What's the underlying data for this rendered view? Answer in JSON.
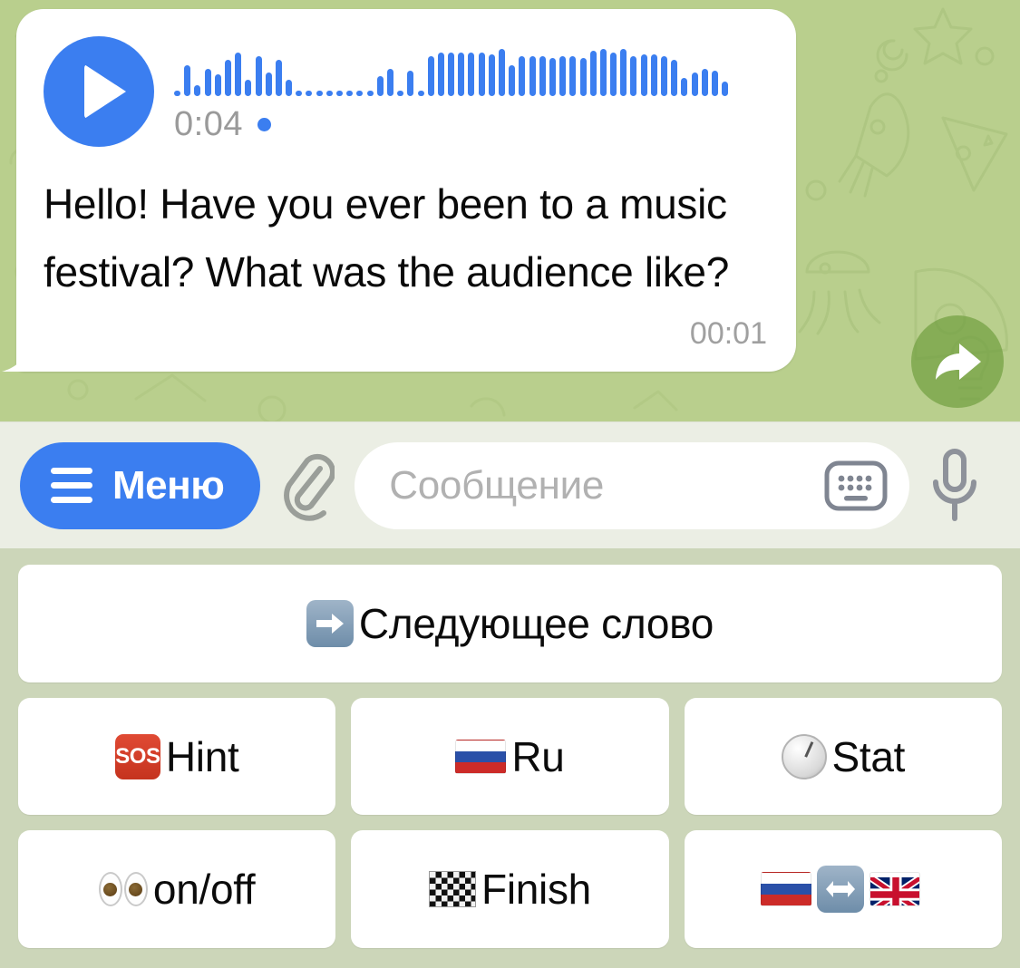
{
  "chat": {
    "background_color": "#b9cf8d",
    "bubble": {
      "voice_message": {
        "duration": "0:04",
        "play_icon": "play-icon",
        "unread_marker": "unread-dot",
        "accent_color": "#3b7ef0",
        "waveform_heights": [
          6,
          34,
          12,
          30,
          24,
          40,
          48,
          18,
          44,
          26,
          40,
          18,
          6,
          6,
          6,
          6,
          6,
          6,
          6,
          6,
          22,
          30,
          6,
          28,
          6,
          44,
          48,
          48,
          48,
          48,
          48,
          46,
          52,
          34,
          44,
          44,
          44,
          42,
          44,
          44,
          42,
          50,
          52,
          48,
          52,
          44,
          46,
          46,
          44,
          40,
          20,
          26,
          30,
          28,
          16
        ]
      },
      "text": "Hello! Have you ever been to a music festival? What was the audience like?",
      "time": "00:01"
    },
    "forward_button": {
      "icon": "forward-arrow-icon",
      "color": "#71a041"
    }
  },
  "input_bar": {
    "menu_button": {
      "label": "Меню",
      "icon": "hamburger-icon",
      "color": "#3b7ef0"
    },
    "attach_icon": "paperclip-icon",
    "message_field": {
      "value": "",
      "placeholder": "Сообщение"
    },
    "keyboard_toggle_icon": "keyboard-icon",
    "mic_icon": "microphone-icon"
  },
  "reply_keyboard": {
    "rows": [
      [
        {
          "emoji": "➡️",
          "emoji_name": "arrow-right-emoji",
          "label": "Следующее слово",
          "name": "next-word"
        }
      ],
      [
        {
          "emoji": "🆘",
          "emoji_name": "sos-emoji",
          "label": "Hint",
          "name": "hint"
        },
        {
          "emoji": "🇷🇺",
          "emoji_name": "flag-ru-emoji",
          "label": "Ru",
          "name": "ru"
        },
        {
          "emoji": "🕐",
          "emoji_name": "clock-emoji",
          "label": "Stat",
          "name": "stat"
        }
      ],
      [
        {
          "emoji": "👀",
          "emoji_name": "eyes-emoji",
          "label": "on/off",
          "name": "on-off"
        },
        {
          "emoji": "🏁",
          "emoji_name": "chequered-flag-emoji",
          "label": "Finish",
          "name": "finish"
        },
        {
          "emoji": "🇷🇺↔️🇬🇧",
          "emoji_name": "flag-swap-emoji",
          "label": "",
          "name": "lang-swap"
        }
      ]
    ],
    "background_color": "#ccd6b9"
  }
}
